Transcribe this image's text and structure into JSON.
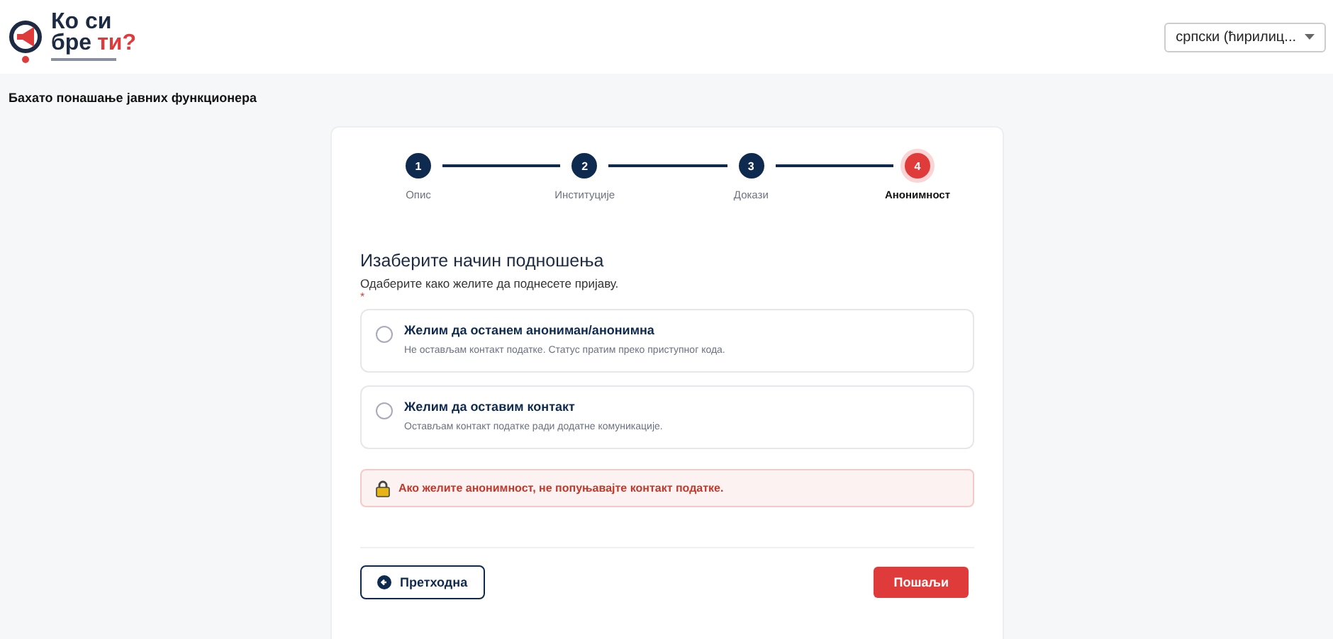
{
  "logo": {
    "line_1": "Ко си",
    "line_2": "бре",
    "line_2_accent": "ти?"
  },
  "language": {
    "value": "српски (ћирилиц..."
  },
  "page_title": "Бахато понашање јавних функционера",
  "steps": [
    {
      "number": "1",
      "label": "Опис",
      "selected": false
    },
    {
      "number": "2",
      "label": "Институције",
      "selected": false
    },
    {
      "number": "3",
      "label": "Докази",
      "selected": false
    },
    {
      "number": "4",
      "label": "Анонимност",
      "selected": true
    }
  ],
  "form": {
    "heading": "Изаберите начин подношења",
    "hint": "Одаберите како желите да поднесете пријаву.",
    "required_mark": "*",
    "options": [
      {
        "title": "Желим да останем анониман/анонимна",
        "description": "Не остављам контакт податке. Статус пратим преко приступног кода.",
        "selected": false
      },
      {
        "title": "Желим да оставим контакт",
        "description": "Остављам контакт податке ради додатне комуникације.",
        "selected": false
      }
    ],
    "warning": "Ако желите анонимност, не попуњавајте контакт податке.",
    "back_button": "Претходна",
    "submit_button": "Пошаљи"
  }
}
